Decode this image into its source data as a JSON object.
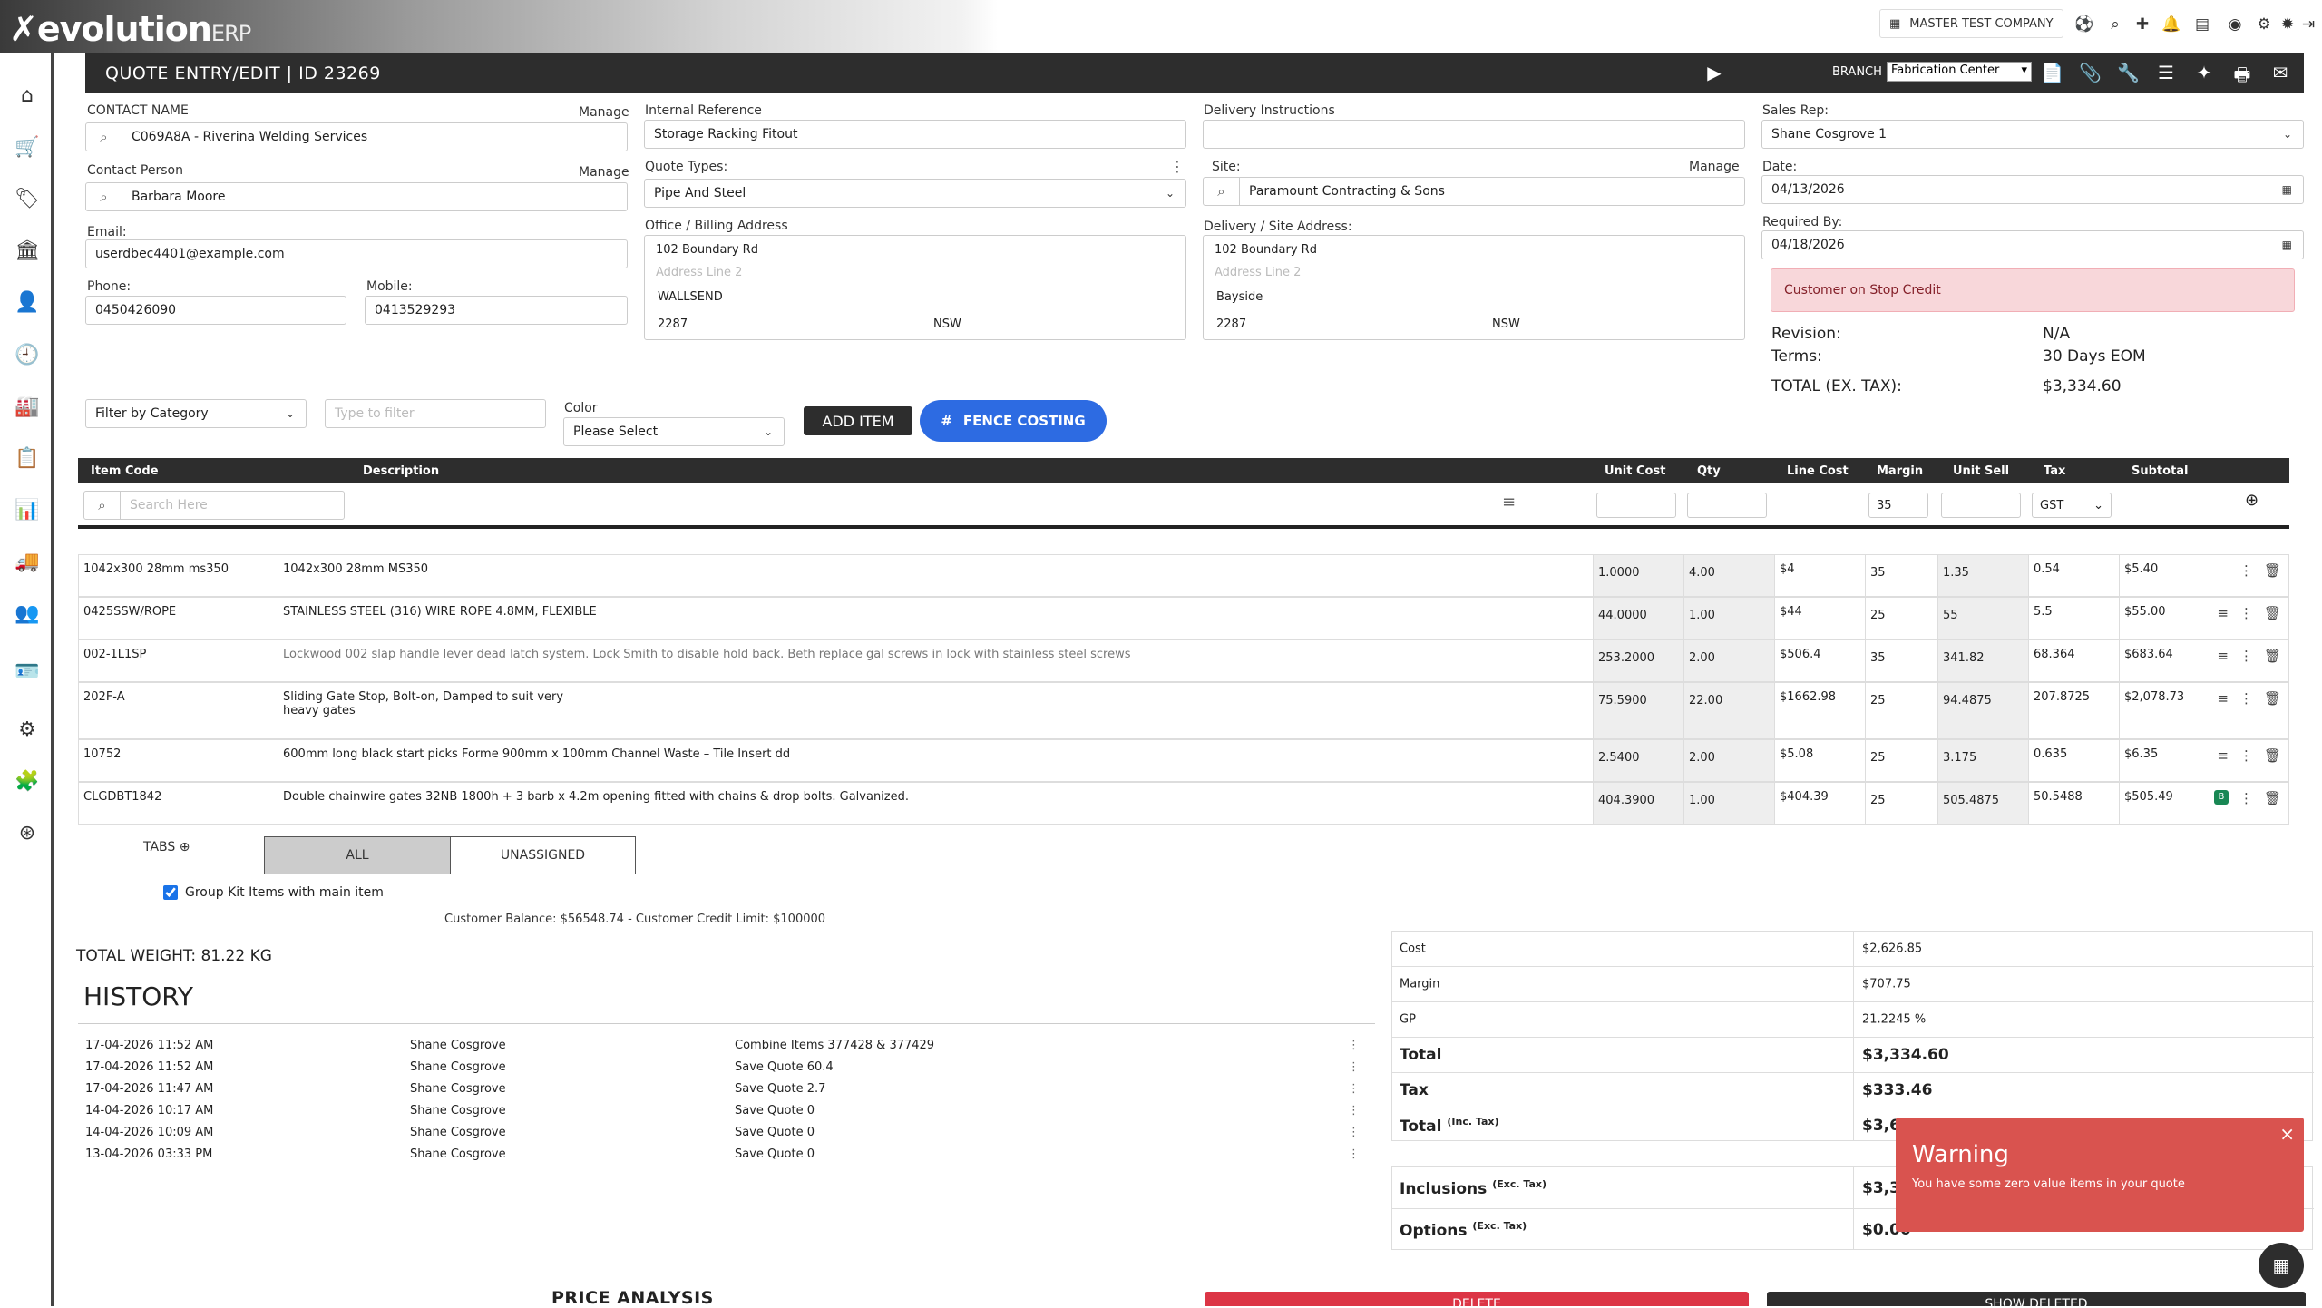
{
  "app": {
    "logo_main": "evolution",
    "logo_sub": "ERP",
    "company": "MASTER TEST COMPANY"
  },
  "header": {
    "title": "QUOTE ENTRY/EDIT | ID 23269",
    "branch_label": "BRANCH",
    "branch_value": "Fabrication Center"
  },
  "contact": {
    "label": "CONTACT NAME",
    "manage": "Manage",
    "value": "C069A8A - Riverina Welding Services",
    "person_label": "Contact Person",
    "person_manage": "Manage",
    "person_value": "Barbara Moore",
    "email_label": "Email:",
    "email_value": "userdbec4401@example.com",
    "phone_label": "Phone:",
    "phone_value": "0450426090",
    "mobile_label": "Mobile:",
    "mobile_value": "0413529293"
  },
  "internal": {
    "label": "Internal Reference",
    "value": "Storage Racking Fitout"
  },
  "quote_types": {
    "label": "Quote Types:",
    "value": "Pipe And Steel"
  },
  "billing": {
    "label": "Office / Billing Address",
    "line1": "102 Boundary Rd",
    "line2_ph": "Address Line 2",
    "city": "WALLSEND",
    "postcode": "2287",
    "state": "NSW"
  },
  "delivery_instr": {
    "label": "Delivery Instructions",
    "value": ""
  },
  "site": {
    "label": "Site:",
    "manage": "Manage",
    "value": "Paramount Contracting & Sons"
  },
  "delivery_addr": {
    "label": "Delivery / Site Address:",
    "line1": "102 Boundary Rd",
    "line2_ph": "Address Line 2",
    "city": "Bayside",
    "postcode": "2287",
    "state": "NSW"
  },
  "sales": {
    "label": "Sales Rep:",
    "value": "Shane Cosgrove 1",
    "date_label": "Date:",
    "date_value": "04/13/2026",
    "req_label": "Required By:",
    "req_value": "04/18/2026"
  },
  "alert": {
    "stop_credit": "Customer on Stop Credit"
  },
  "summary_top": {
    "revision_k": "Revision:",
    "revision_v": "N/A",
    "terms_k": "Terms:",
    "terms_v": "30 Days EOM",
    "total_k": "TOTAL (EX. TAX):",
    "total_v": "$3,334.60"
  },
  "filters": {
    "category": "Filter by Category",
    "filter_ph": "Type to filter",
    "color_label": "Color",
    "color_value": "Please Select",
    "add_item": "ADD ITEM",
    "fence": "FENCE COSTING"
  },
  "grid": {
    "headers": {
      "code": "Item Code",
      "desc": "Description",
      "ucost": "Unit Cost",
      "qty": "Qty",
      "lcost": "Line Cost",
      "margin": "Margin",
      "usell": "Unit Sell",
      "tax": "Tax",
      "subtotal": "Subtotal"
    },
    "search_ph": "Search Here",
    "entry_margin": "35",
    "entry_tax": "GST",
    "rows": [
      {
        "code": "1042x300 28mm ms350",
        "desc": "1042x300 28mm  MS350",
        "desc2": "",
        "ucost": "1.0000",
        "qty": "4.00",
        "lcost": "$4",
        "margin": "35",
        "usell": "1.35",
        "tax": "0.54",
        "subtotal": "$5.40"
      },
      {
        "code": "0425SSW/ROPE",
        "desc": "STAINLESS STEEL (316) WIRE ROPE 4.8MM, FLEXIBLE",
        "desc2": "",
        "ucost": "44.0000",
        "qty": "1.00",
        "lcost": "$44",
        "margin": "25",
        "usell": "55",
        "tax": "5.5",
        "subtotal": "$55.00"
      },
      {
        "code": "002-1L1SP",
        "desc": "Lockwood  002 slap handle lever dead latch system. Lock Smith to disable hold back. Beth replace gal screws in lock with stainless steel screws",
        "desc2": "",
        "ucost": "253.2000",
        "qty": "2.00",
        "lcost": "$506.4",
        "margin": "35",
        "usell": "341.82",
        "tax": "68.364",
        "subtotal": "$683.64"
      },
      {
        "code": "202F-A",
        "desc": "Sliding Gate Stop, Bolt-on, Damped to suit very",
        "desc2": "heavy gates",
        "ucost": "75.5900",
        "qty": "22.00",
        "lcost": "$1662.98",
        "margin": "25",
        "usell": "94.4875",
        "tax": "207.8725",
        "subtotal": "$2,078.73"
      },
      {
        "code": "10752",
        "desc": "600mm long black start picks Forme 900mm x 100mm Channel Waste – Tile Insert dd",
        "desc2": "",
        "ucost": "2.5400",
        "qty": "2.00",
        "lcost": "$5.08",
        "margin": "25",
        "usell": "3.175",
        "tax": "0.635",
        "subtotal": "$6.35"
      },
      {
        "code": "CLGDBT1842",
        "desc": "Double chainwire gates 32NB 1800h + 3 barb x 4.2m opening fitted with chains & drop bolts. Galvanized.",
        "desc2": "",
        "ucost": "404.3900",
        "qty": "1.00",
        "lcost": "$404.39",
        "margin": "25",
        "usell": "505.4875",
        "tax": "50.5488",
        "subtotal": "$505.49"
      }
    ]
  },
  "tabs": {
    "label": "TABS",
    "all": "ALL",
    "unassigned": "UNASSIGNED",
    "group_kit": "Group Kit Items with main item"
  },
  "balance": "Customer Balance: $56548.74 - Customer Credit Limit: $100000",
  "weight": "TOTAL WEIGHT: 81.22 KG",
  "history": {
    "title": "HISTORY",
    "rows": [
      {
        "date": "17-04-2026 11:52 AM",
        "user": "Shane Cosgrove",
        "action": "Combine Items 377428 & 377429"
      },
      {
        "date": "17-04-2026 11:52 AM",
        "user": "Shane Cosgrove",
        "action": "Save Quote 60.4"
      },
      {
        "date": "17-04-2026 11:47 AM",
        "user": "Shane Cosgrove",
        "action": "Save Quote 2.7"
      },
      {
        "date": "14-04-2026 10:17 AM",
        "user": "Shane Cosgrove",
        "action": "Save Quote 0"
      },
      {
        "date": "14-04-2026 10:09 AM",
        "user": "Shane Cosgrove",
        "action": "Save Quote 0"
      },
      {
        "date": "13-04-2026 03:33 PM",
        "user": "Shane Cosgrove",
        "action": "Save Quote 0"
      }
    ]
  },
  "totals": {
    "cost_k": "Cost",
    "cost_v": "$2,626.85",
    "margin_k": "Margin",
    "margin_v": "$707.75",
    "gp_k": "GP",
    "gp_v": "21.2245 %",
    "total_k": "Total",
    "total_v": "$3,334.60",
    "tax_k": "Tax",
    "tax_v": "$333.46",
    "total_inc_k": "Total",
    "total_inc_sup": "(Inc. Tax)",
    "total_inc_v": "$3,6",
    "incl_k": "Inclusions",
    "incl_sup": "(Exc. Tax)",
    "incl_v": "$3,3",
    "opt_k": "Options",
    "opt_sup": "(Exc. Tax)",
    "opt_v": "$0.00"
  },
  "warning": {
    "title": "Warning",
    "message": "You have some zero value items in your quote",
    "close": "×"
  },
  "bottom": {
    "price_analysis": "PRICE ANALYSIS",
    "delete": "DELETE",
    "show_deleted": "SHOW DELETED"
  }
}
